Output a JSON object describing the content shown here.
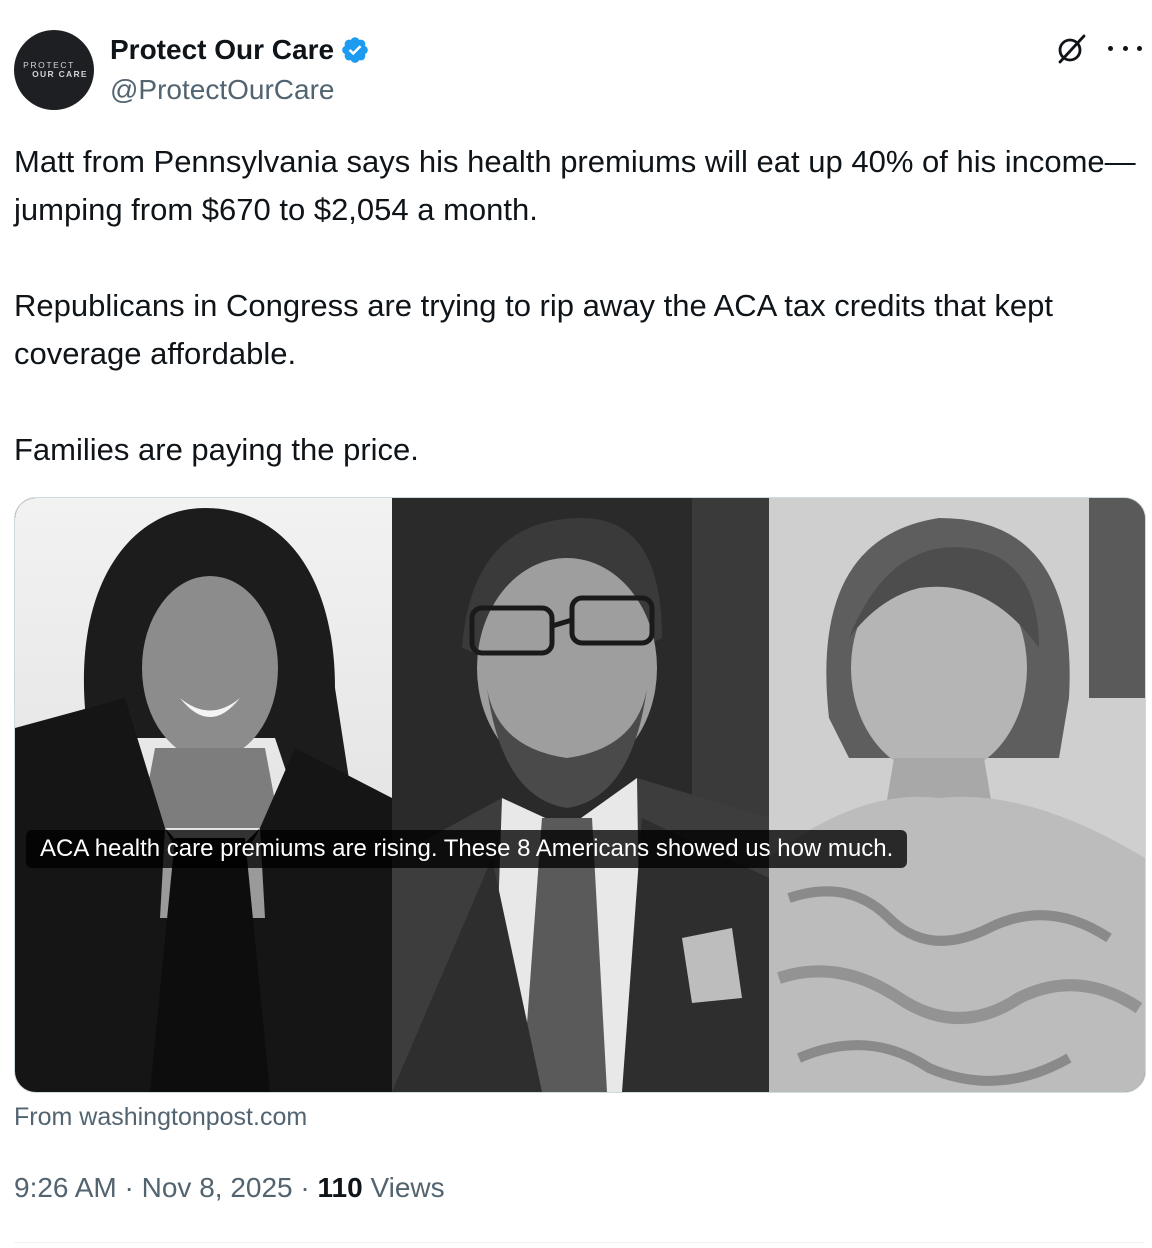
{
  "author": {
    "avatar_line1": "PROTECT",
    "avatar_line2": "OUR CARE",
    "name": "Protect Our Care",
    "handle": "@ProtectOurCare",
    "verified": true
  },
  "tweet": {
    "paragraphs": [
      "Matt from Pennsylvania says his health premiums will eat up 40% of his income—jumping from $670 to $2,054 a month.",
      "Republicans in Congress are trying to rip away the ACA tax credits that kept coverage affordable.",
      "Families are paying the price."
    ]
  },
  "card": {
    "caption": "ACA health care premiums are rising. These 8 Americans showed us how much.",
    "source": "From washingtonpost.com"
  },
  "meta": {
    "time": "9:26 AM",
    "sep1": " · ",
    "date": "Nov 8, 2025",
    "sep2": " · ",
    "views_count": "110",
    "views_label": " Views"
  },
  "icons": {
    "verified": "verified-badge-icon",
    "grok": "grok-icon",
    "more": "more-options-icon"
  },
  "colors": {
    "verified": "#1d9bf0",
    "text": "#0f1419",
    "secondary": "#536471"
  }
}
